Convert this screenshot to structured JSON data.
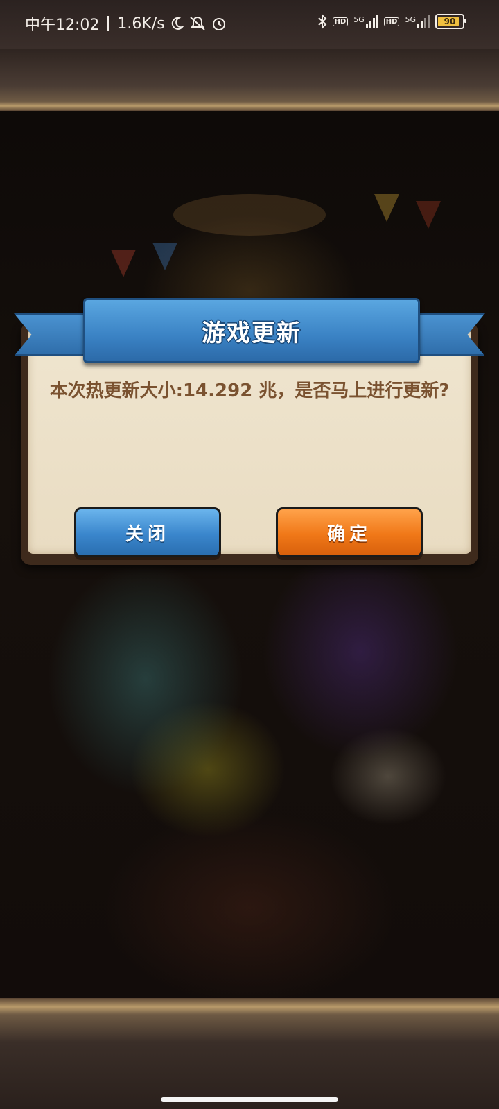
{
  "status_bar": {
    "time": "中午12:02",
    "network_speed": "1.6K/s",
    "icons": [
      "moon-icon",
      "mute-icon",
      "alarm-icon",
      "bluetooth-icon",
      "hd-icon",
      "signal-5g-icon",
      "hd-icon",
      "signal-5g-icon",
      "battery-icon"
    ],
    "hd_label": "HD",
    "network_type_1": "5G",
    "network_type_2": "5G",
    "battery_level": "90"
  },
  "dialog": {
    "title": "游戏更新",
    "message": "本次热更新大小:14.292 兆，是否马上进行更新?",
    "close_button": "关闭",
    "confirm_button": "确定"
  },
  "colors": {
    "ribbon_blue": "#3a82c4",
    "close_blue": "#3a86cc",
    "confirm_orange": "#f07818",
    "parchment": "#efe5cf",
    "message_brown": "#7a5230"
  }
}
